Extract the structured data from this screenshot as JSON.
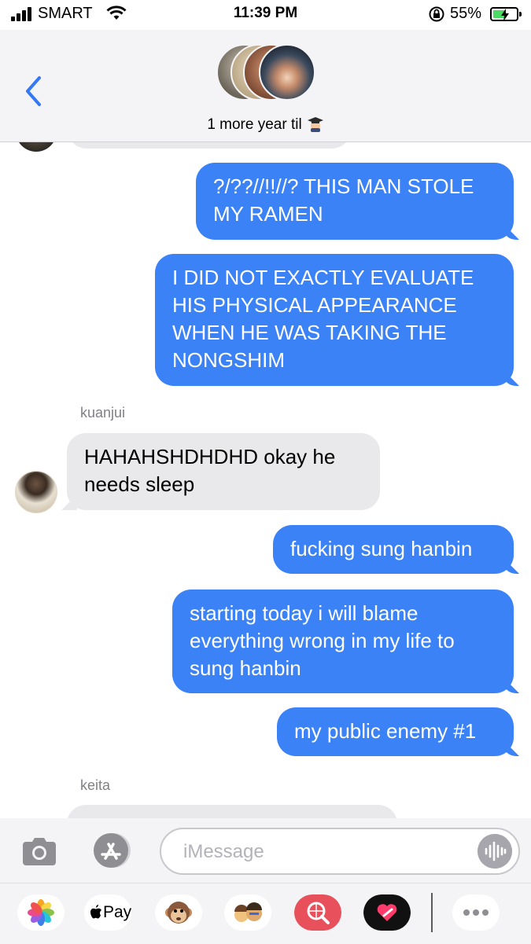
{
  "status_bar": {
    "carrier": "SMART",
    "time": "11:39 PM",
    "battery_percent": "55%",
    "battery_level": 0.55,
    "icons": [
      "signal-icon",
      "wifi-icon",
      "orientation-lock-icon",
      "battery-charging-icon"
    ]
  },
  "header": {
    "conversation_title": "1 more year til",
    "title_emoji": "graduation-cap-emoji",
    "back_icon": "chevron-left-icon",
    "accent_color": "#3478f6"
  },
  "messages": [
    {
      "type": "outgoing",
      "text": "?/??//!!//? THIS MAN STOLE MY RAMEN"
    },
    {
      "type": "outgoing",
      "text": "I DID NOT EXACTLY EVALUATE HIS PHYSICAL APPEARANCE WHEN HE WAS TAKING THE NONGSHIM"
    },
    {
      "type": "sender",
      "text": "kuanjui"
    },
    {
      "type": "incoming",
      "text": "HAHAHSHDHDHD okay he needs sleep"
    },
    {
      "type": "outgoing",
      "text": "fucking sung hanbin"
    },
    {
      "type": "outgoing",
      "text": "starting today i will blame everything wrong in my life to sung hanbin"
    },
    {
      "type": "outgoing",
      "text": "my public enemy #1"
    },
    {
      "type": "sender",
      "text": "keita"
    }
  ],
  "colors": {
    "outgoing_bubble": "#3a82f6",
    "incoming_bubble": "#e9e9eb"
  },
  "composer": {
    "placeholder": "iMessage",
    "camera_icon": "camera-icon",
    "apps_icon": "app-store-icon",
    "audio_icon": "audio-waveform-icon"
  },
  "app_drawer": {
    "apple_pay_label": "Pay",
    "apps": [
      "photos-icon",
      "apple-pay-icon",
      "monkey-animoji-icon",
      "memoji-icon",
      "web-search-icon",
      "digital-touch-icon",
      "more-icon"
    ]
  }
}
